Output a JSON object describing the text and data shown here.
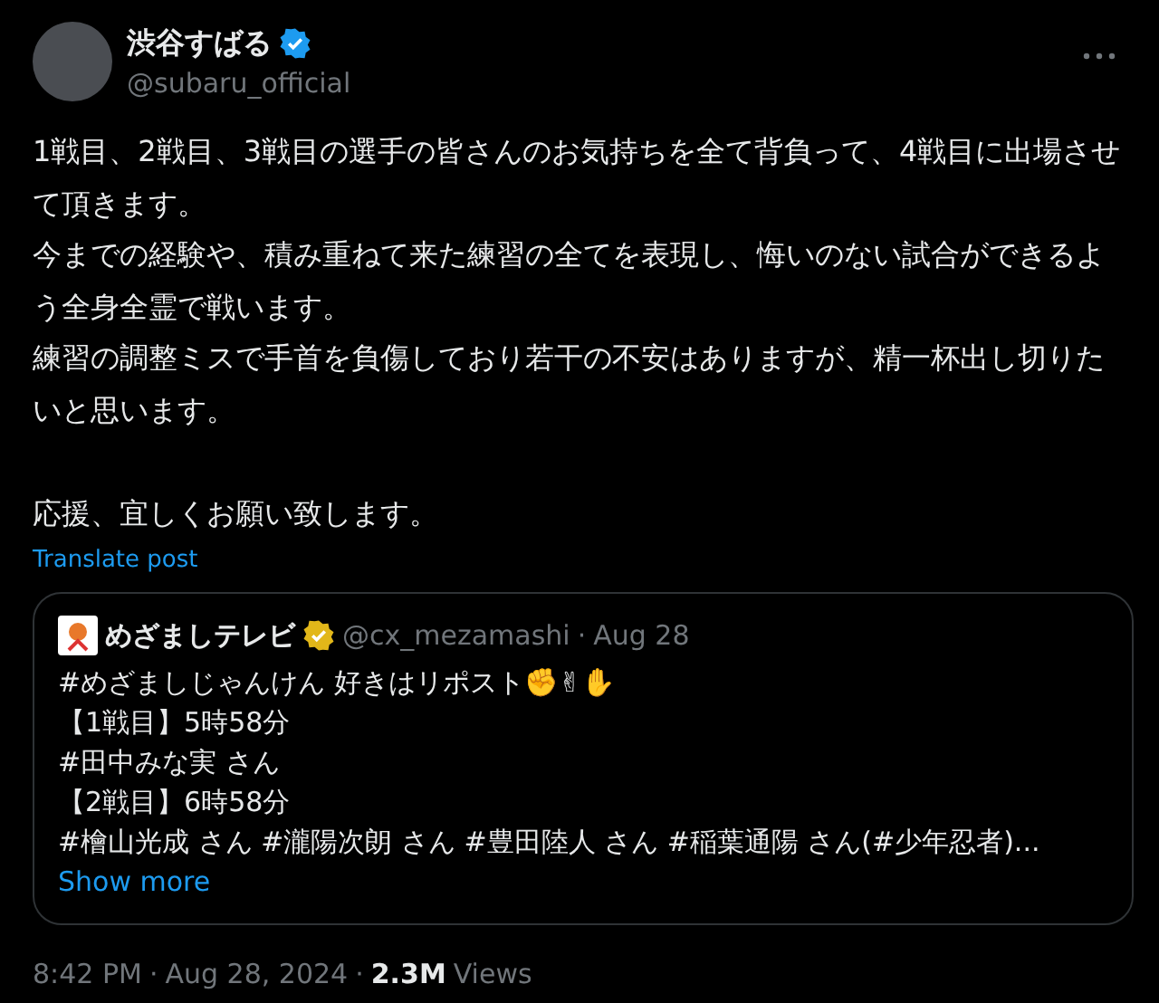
{
  "author": {
    "name": "渋谷すばる",
    "handle": "@subaru_official",
    "verified": true
  },
  "body": [
    [
      "1戦目、2戦目、3戦目の選手の皆さんのお気持ちを全て背負って、4戦目に出場させて頂きます。",
      "今までの経験や、積み重ねて来た練習の全てを表現し、悔いのない試合ができるよう全身全霊で戦います。",
      "練習の調整ミスで手首を負傷しており若干の不安はありますが、精一杯出し切りたいと思います。"
    ],
    [
      "応援、宜しくお願い致します。"
    ]
  ],
  "translate_link": "Translate post",
  "quote": {
    "name": "めざましテレビ",
    "verified": true,
    "handle": "@cx_mezamashi",
    "separator": "·",
    "date": "Aug 28",
    "lines": [
      "#めざましじゃんけん 好きはリポスト✊✌✋",
      "【1戦目】5時58分",
      "#田中みな実 さん",
      "【2戦目】6時58分",
      "#檜山光成 さん #瀧陽次朗 さん #豊田陸人 さん #稲葉通陽 さん(#少年忍者)..."
    ],
    "show_more": "Show more"
  },
  "footer": {
    "time": "8:42 PM",
    "separator": "·",
    "date": "Aug 28, 2024",
    "separator_2": "·",
    "views_count": "2.3M",
    "views_label": "Views"
  }
}
